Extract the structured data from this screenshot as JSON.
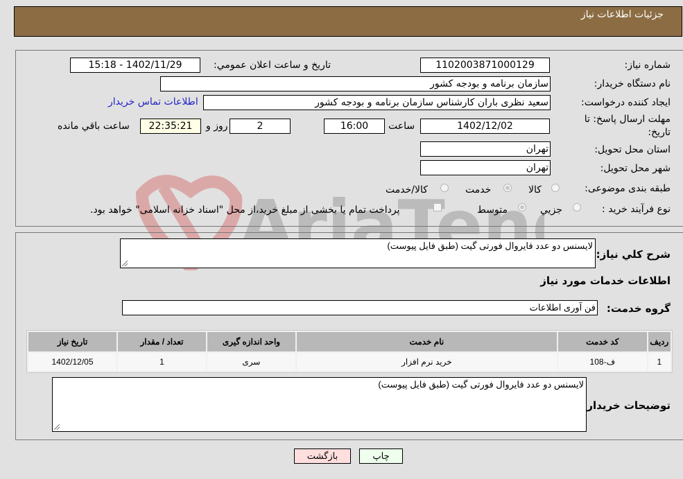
{
  "header": {
    "title": "جزئيات اطلاعات نياز"
  },
  "form": {
    "need_number_label": "شماره نياز:",
    "need_number": "1102003871000129",
    "announce_label": "تاريخ و ساعت اعلان عمومي:",
    "announce_value": "1402/11/29 - 15:18",
    "buyer_org_label": "نام دستگاه خريدار:",
    "buyer_org": "سازمان برنامه و بودجه کشور",
    "creator_label": "ايجاد کننده درخواست:",
    "creator": "سعيد نظری باران کارشناس سازمان برنامه و بودجه کشور",
    "contact_link": "اطلاعات تماس خريدار",
    "deadline_label_1": "مهلت ارسال پاسخ: تا",
    "deadline_label_2": "تاريخ:",
    "deadline_date": "1402/12/02",
    "time_label": "ساعت",
    "deadline_time": "16:00",
    "days_value": "2",
    "days_label": "روز و",
    "remaining_time": "22:35:21",
    "remaining_label": "ساعت باقي مانده",
    "province_label": "استان محل تحويل:",
    "province": "تهران",
    "city_label": "شهر محل تحويل:",
    "city": "تهران",
    "category_label": "طبقه بندی موضوعی:",
    "category_options": [
      {
        "label": "کالا",
        "checked": false
      },
      {
        "label": "خدمت",
        "checked": true
      },
      {
        "label": "کالا/خدمت",
        "checked": false
      }
    ],
    "process_label": "نوع فرآيند خريد :",
    "process_options": [
      {
        "label": "جزيي",
        "checked": false
      },
      {
        "label": "متوسط",
        "checked": true
      }
    ],
    "treasury_note": "پرداخت تمام يا بخشی از مبلغ خريد،از محل \"اسناد خزانه اسلامی\" خواهد بود."
  },
  "details": {
    "description_label": "شرح کلي نياز:",
    "description": "لايسنس دو عدد فايروال فورتی گيت (طبق فايل پيوست)",
    "services_heading": "اطلاعات خدمات مورد نياز",
    "service_group_label": "گروه خدمت:",
    "service_group": "فن آوری اطلاعات",
    "table": {
      "headers": [
        "رديف",
        "کد خدمت",
        "نام خدمت",
        "واحد اندازه گيری",
        "تعداد / مقدار",
        "تاريخ نياز"
      ],
      "rows": [
        [
          "1",
          "ف-108",
          "خريد نرم افزار",
          "سری",
          "1",
          "1402/12/05"
        ]
      ]
    },
    "buyer_notes_label": "توضيحات خريدار:",
    "buyer_notes": "لايسنس دو عدد فايروال فورتی گيت (طبق فايل پيوست)"
  },
  "buttons": {
    "print": "چاپ",
    "back": "بازگشت"
  },
  "watermark": {
    "text": "AriaTender.neT"
  }
}
